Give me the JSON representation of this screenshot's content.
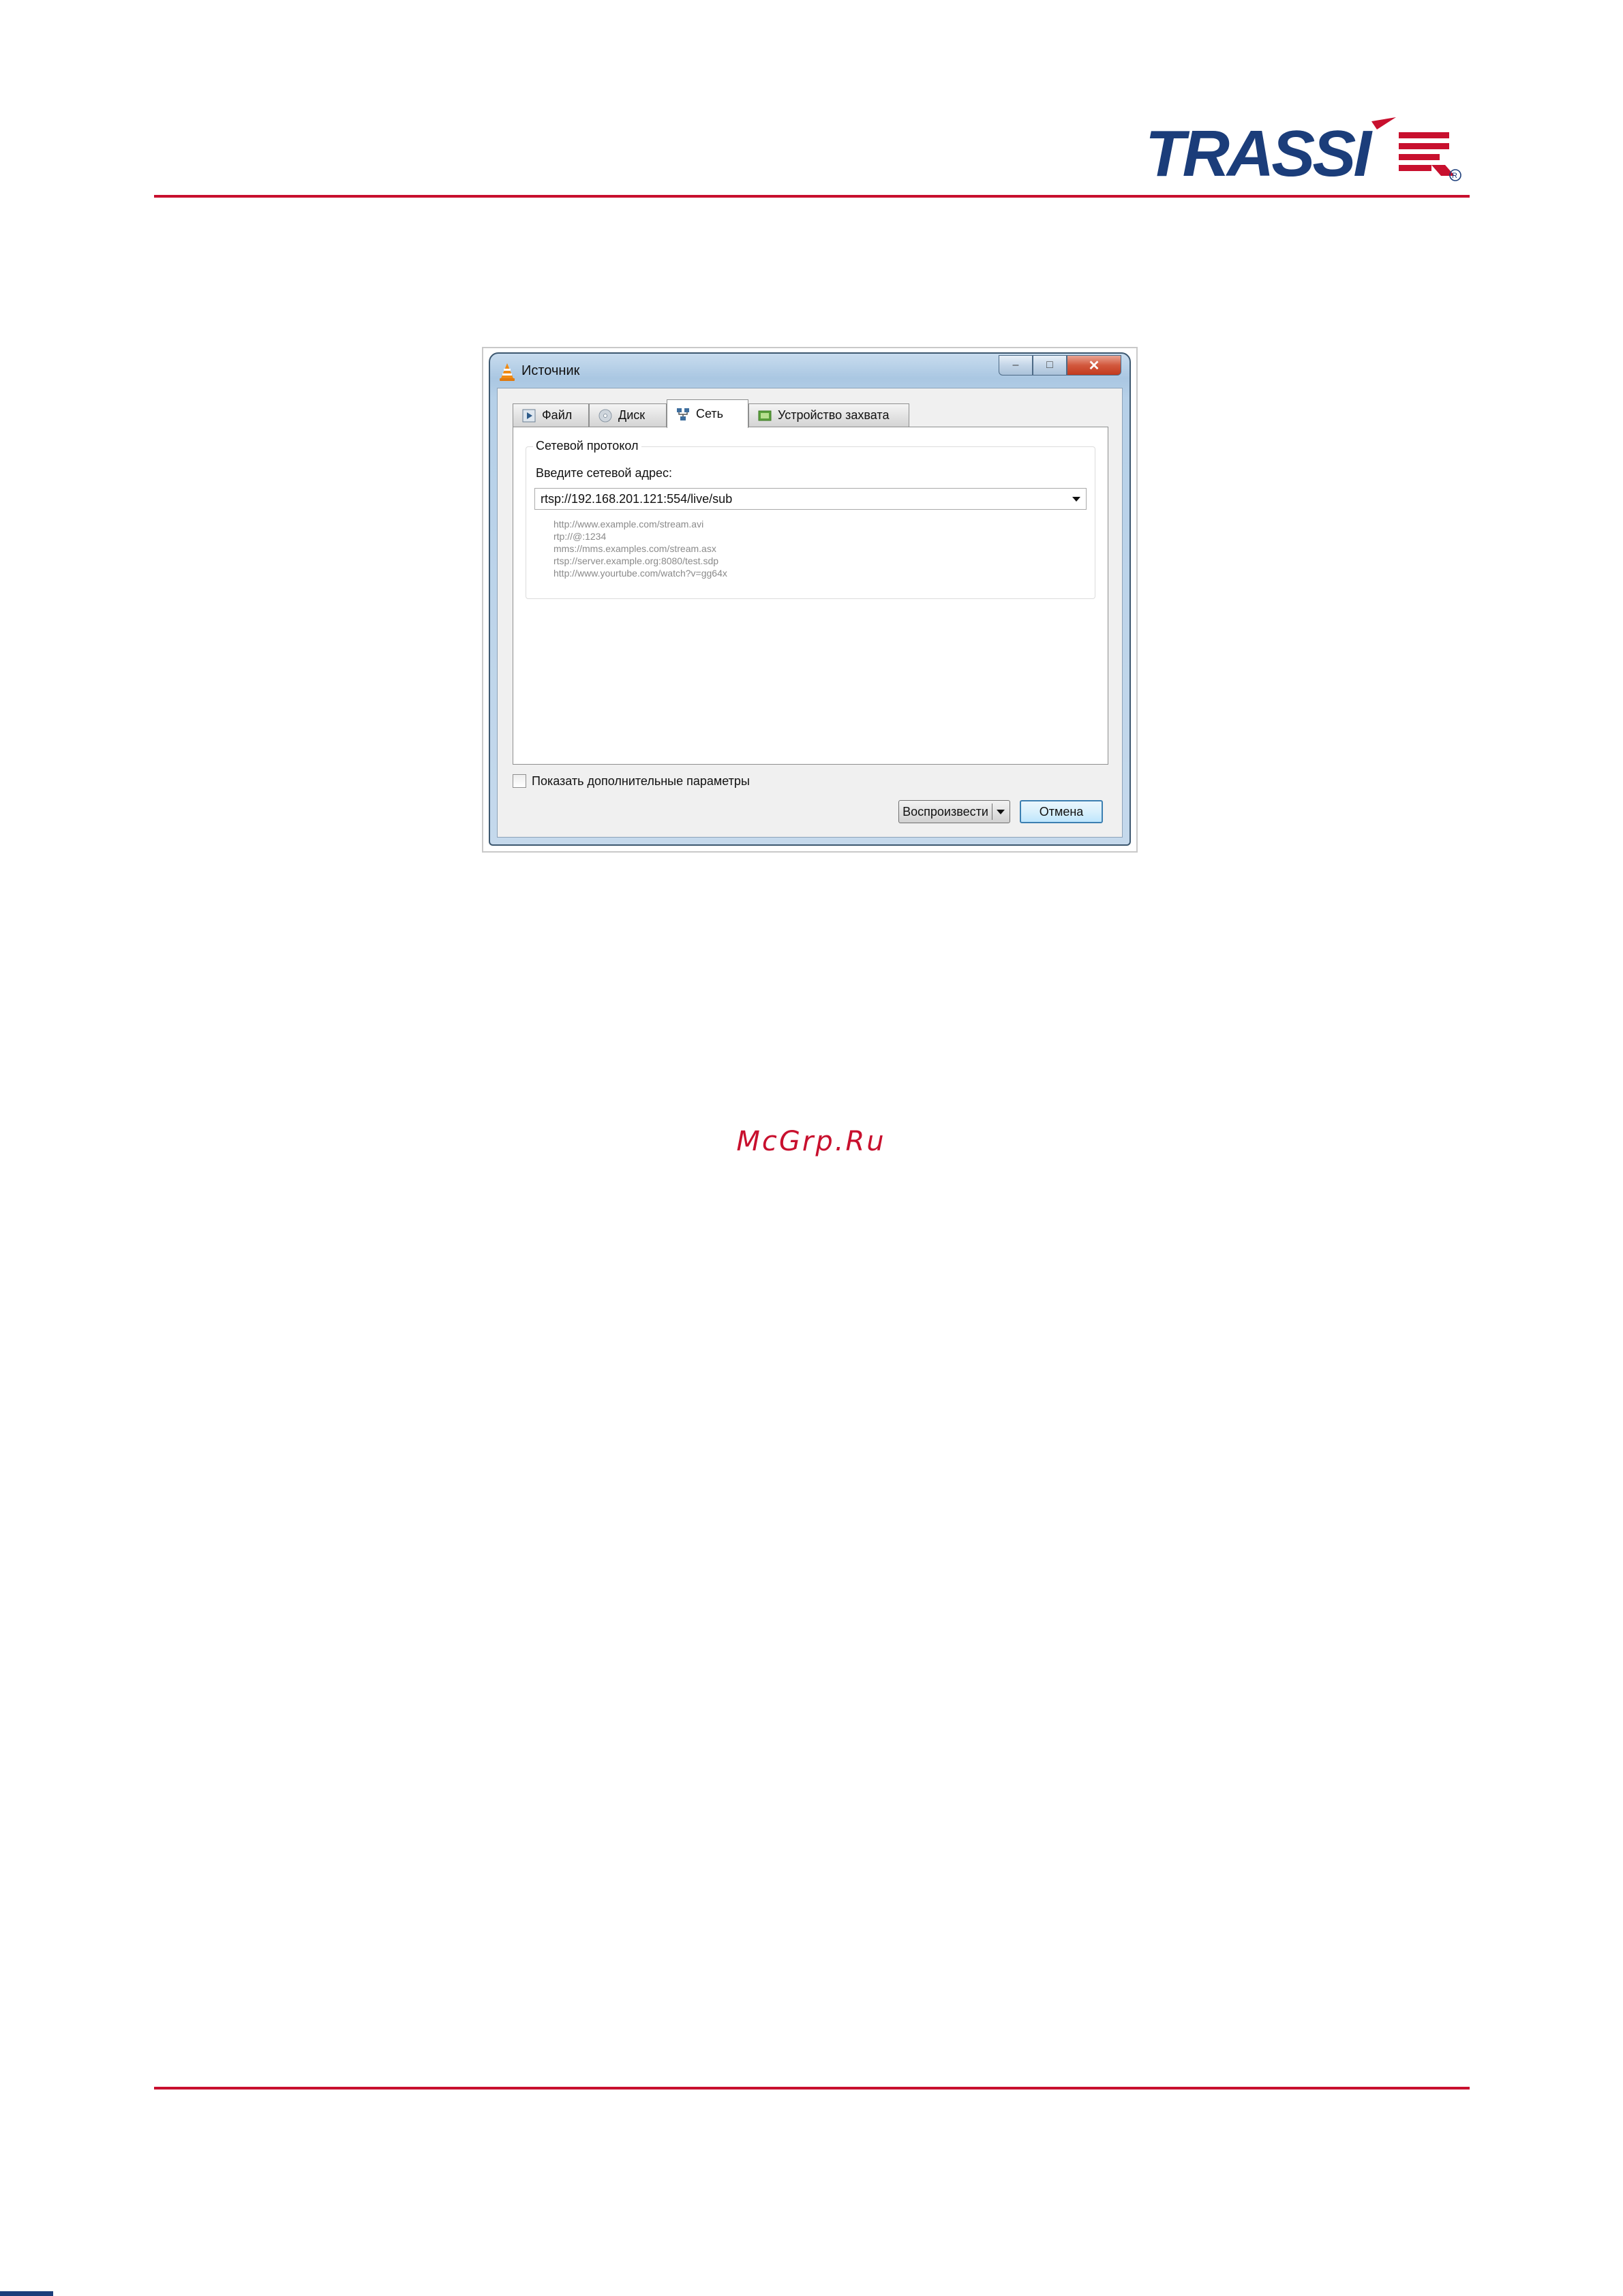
{
  "header": {
    "logo_text": "TRASSIR",
    "logo_registered": "®"
  },
  "dialog": {
    "title": "Источник",
    "caption_buttons": {
      "minimize": "–",
      "maximize": "□",
      "close": "✕"
    },
    "tabs": [
      {
        "label": "Файл",
        "icon": "play-file-icon"
      },
      {
        "label": "Диск",
        "icon": "disc-icon"
      },
      {
        "label": "Сеть",
        "icon": "network-icon",
        "active": true
      },
      {
        "label": "Устройство захвата",
        "icon": "capture-device-icon"
      }
    ],
    "group_title": "Сетевой протокол",
    "address_label": "Введите сетевой адрес:",
    "address_value": "rtsp://192.168.201.121:554/live/sub",
    "examples": [
      "http://www.example.com/stream.avi",
      "rtp://@:1234",
      "mms://mms.examples.com/stream.asx",
      "rtsp://server.example.org:8080/test.sdp",
      "http://www.yourtube.com/watch?v=gg64x"
    ],
    "show_more_options": "Показать дополнительные параметры",
    "show_more_checked": false,
    "play_button": "Воспроизвести",
    "cancel_button": "Отмена"
  },
  "watermark": "McGrp.Ru",
  "colors": {
    "brand_blue": "#1b3d7a",
    "brand_red": "#c8102e",
    "window_frame": "#aac7e2"
  }
}
